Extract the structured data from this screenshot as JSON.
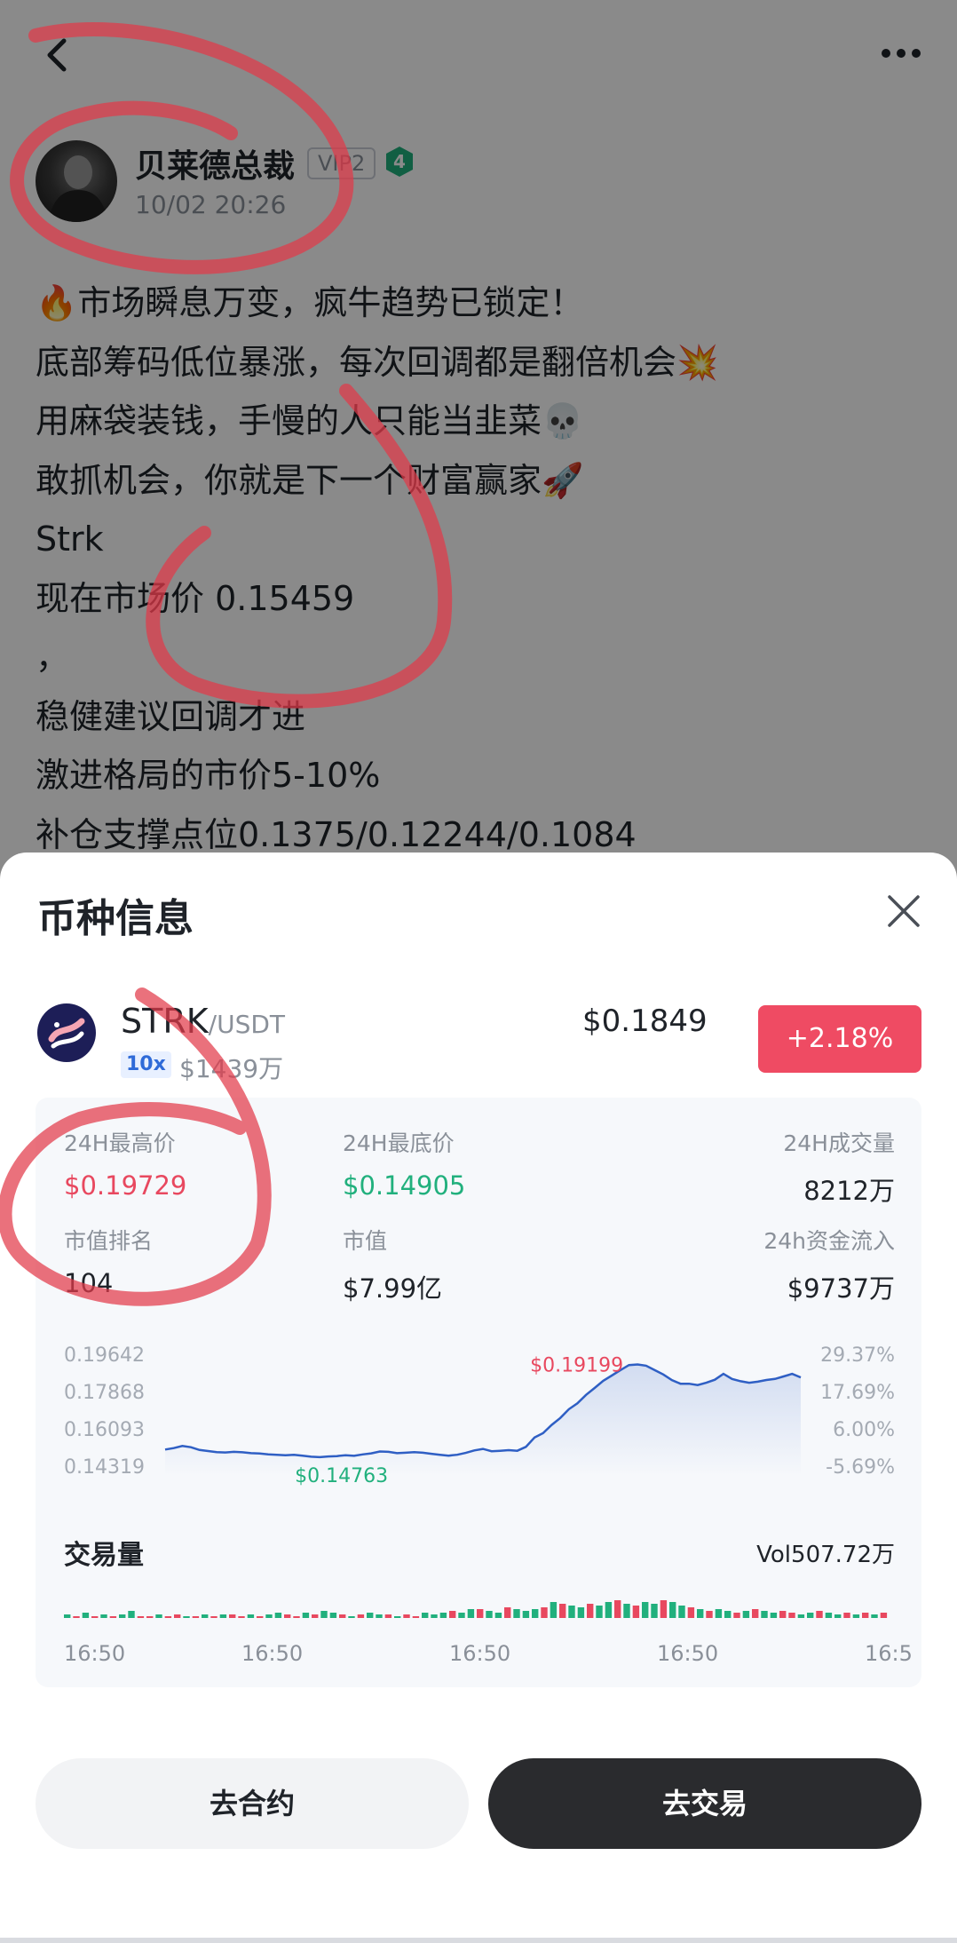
{
  "post": {
    "author": "贝莱德总裁",
    "vip_badge": "VIP2",
    "level": "4",
    "time": "10/02 20:26",
    "lines": [
      "🔥市场瞬息万变，疯牛趋势已锁定！",
      "底部筹码低位暴涨，每次回调都是翻倍机会💥",
      "用麻袋装钱，手慢的人只能当韭菜💀",
      "敢抓机会，你就是下一个财富赢家🚀",
      "Strk",
      "现在市场价  0.15459",
      "，",
      "稳健建议回调才进",
      "激进格局的市价5-10%",
      "补仓支撑点位0.1375/0.12244/0.1084"
    ]
  },
  "sheet": {
    "title": "币种信息",
    "coin": {
      "symbol": "STRK",
      "pair": "/USDT",
      "leverage": "10x",
      "market_cap_short": "$1439万",
      "price": "$0.1849",
      "change": "+2.18%"
    },
    "stats": {
      "high_label": "24H最高价",
      "high_value": "$0.19729",
      "low_label": "24H最底价",
      "low_value": "$0.14905",
      "volume_label": "24H成交量",
      "volume_value": "8212万",
      "rank_label": "市值排名",
      "rank_value": "104",
      "mcap_label": "市值",
      "mcap_value": "$7.99亿",
      "inflow_label": "24h资金流入",
      "inflow_value": "$9737万"
    },
    "volume_title": "交易量",
    "volume_value": "Vol507.72万",
    "buttons": {
      "contract": "去合约",
      "trade": "去交易"
    }
  },
  "chart_data": {
    "type": "line",
    "y_ticks": [
      "0.19642",
      "0.17868",
      "0.16093",
      "0.14319"
    ],
    "y_ticks_right": [
      "29.37%",
      "17.69%",
      "6.00%",
      "-5.69%"
    ],
    "ylim": [
      0.14319,
      0.19642
    ],
    "x_labels": [
      "16:50",
      "16:50",
      "16:50",
      "16:50",
      "16:5"
    ],
    "max_label": "$0.19199",
    "min_label": "$0.14763",
    "series": [
      {
        "values": [
          0.1515,
          0.1522,
          0.1532,
          0.1526,
          0.1513,
          0.1508,
          0.1503,
          0.1501,
          0.1504,
          0.1502,
          0.1498,
          0.1496,
          0.1492,
          0.149,
          0.1488,
          0.149,
          0.1486,
          0.1481,
          0.1479,
          0.1482,
          0.1484,
          0.1488,
          0.1485,
          0.1492,
          0.1497,
          0.1506,
          0.1504,
          0.1498,
          0.15,
          0.1503,
          0.15,
          0.1495,
          0.149,
          0.1486,
          0.149,
          0.1499,
          0.1511,
          0.1518,
          0.1507,
          0.1509,
          0.1512,
          0.1509,
          0.1528,
          0.1572,
          0.1593,
          0.1632,
          0.1665,
          0.1707,
          0.1735,
          0.1775,
          0.1808,
          0.1842,
          0.1867,
          0.1893,
          0.1917,
          0.192,
          0.1914,
          0.1893,
          0.1872,
          0.1845,
          0.1828,
          0.1828,
          0.1822,
          0.1833,
          0.1847,
          0.1875,
          0.1851,
          0.184,
          0.1833,
          0.1838,
          0.1846,
          0.1851,
          0.1863,
          0.1875,
          0.1858
        ]
      }
    ],
    "volume": [
      2,
      1,
      3,
      1,
      2,
      1,
      2,
      4,
      1,
      1,
      2,
      1,
      2,
      1,
      1,
      2,
      1,
      2,
      2,
      1,
      2,
      1,
      2,
      3,
      2,
      1,
      3,
      2,
      4,
      3,
      2,
      1,
      2,
      3,
      2,
      2,
      1,
      2,
      1,
      3,
      2,
      3,
      4,
      3,
      5,
      5,
      4,
      3,
      6,
      5,
      4,
      5,
      6,
      9,
      8,
      7,
      6,
      8,
      7,
      9,
      10,
      8,
      7,
      9,
      8,
      10,
      9,
      7,
      6,
      5,
      4,
      5,
      4,
      3,
      4,
      5,
      4,
      3,
      4,
      3,
      2,
      3,
      4,
      3,
      2,
      3,
      2,
      3,
      2,
      3
    ],
    "volume_up": [
      1,
      0,
      1,
      0,
      1,
      0,
      1,
      1,
      0,
      0,
      1,
      0,
      0,
      1,
      0,
      1,
      0,
      1,
      0,
      0,
      1,
      0,
      1,
      1,
      0,
      0,
      1,
      0,
      1,
      1,
      0,
      1,
      0,
      1,
      1,
      0,
      1,
      0,
      0,
      1,
      1,
      1,
      0,
      1,
      1,
      0,
      1,
      1,
      0,
      1,
      1,
      1,
      0,
      1,
      0,
      1,
      1,
      0,
      1,
      1,
      0,
      1,
      0,
      1,
      1,
      0,
      1,
      1,
      0,
      1,
      0,
      1,
      1,
      0,
      1,
      0,
      1,
      1,
      0,
      0,
      1,
      1,
      0,
      1,
      1,
      0,
      1,
      0,
      1,
      0
    ]
  },
  "colors": {
    "up": "#21b07d",
    "down": "#e8485f",
    "line": "#2f5fc4",
    "accent_red": "#ef4b63",
    "dark_button": "#2a2b2e"
  },
  "icons": [
    "back-arrow-icon",
    "more-dots-icon",
    "level-shield-icon",
    "close-icon",
    "starknet-logo-icon"
  ]
}
